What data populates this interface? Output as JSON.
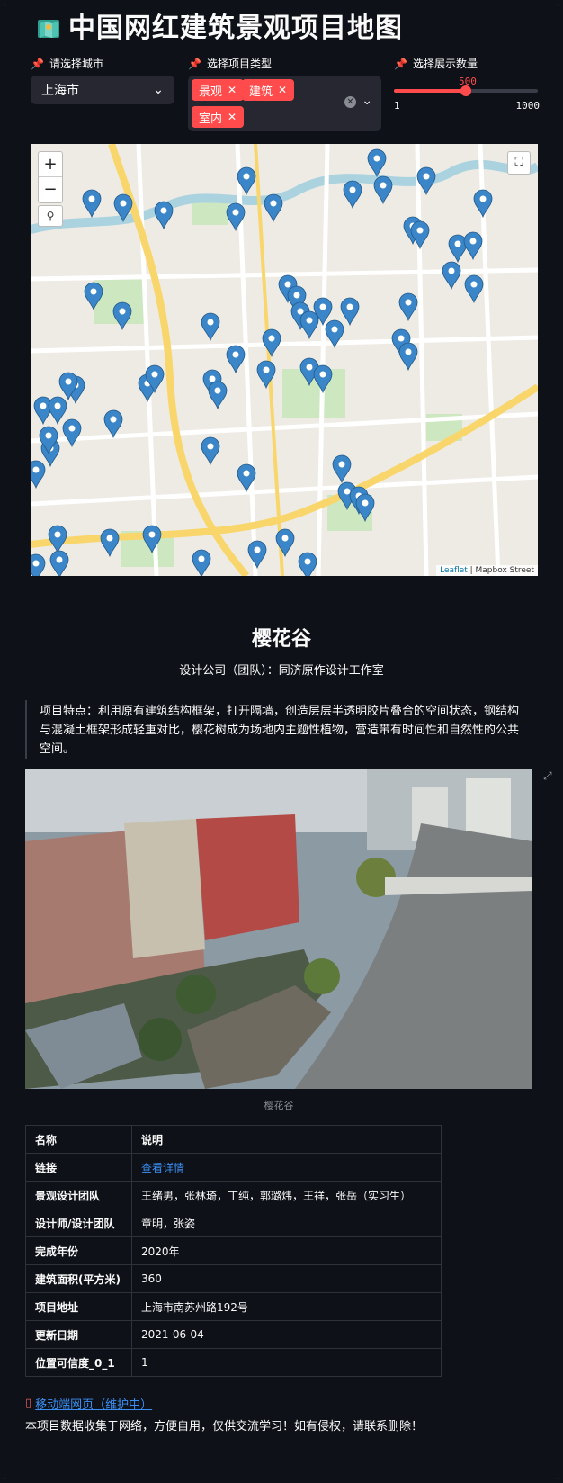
{
  "header": {
    "title": "中国网红建筑景观项目地图",
    "icon": "map-icon"
  },
  "filters": {
    "city_label": "请选择城市",
    "city_value": "上海市",
    "type_label": "选择项目类型",
    "types": [
      "景观",
      "建筑",
      "室内"
    ],
    "count_label": "选择展示数量",
    "count_value": "500",
    "count_min": "1",
    "count_max": "1000",
    "count_fraction": 0.5
  },
  "map": {
    "zoom_in": "+",
    "zoom_out": "−",
    "attribution_leaflet": "Leaflet",
    "attribution_rest": " | Mapbox Street",
    "marker_color": "#3a86c8"
  },
  "project": {
    "name": "樱花谷",
    "company": "设计公司（团队）：同济原作设计工作室",
    "feature": "项目特点：利用原有建筑结构框架，打开隔墙，创造层层半透明胶片叠合的空间状态，钢结构与混凝土框架形成轻重对比，樱花树成为场地内主题性植物，营造带有时间性和自然性的公共空间。",
    "caption": "樱花谷",
    "table": {
      "head": [
        "名称",
        "说明"
      ],
      "rows": [
        [
          "链接",
          "查看详情"
        ],
        [
          "景观设计团队",
          "王绪男，张林琦，丁纯，郭璐炜，王祥，张岳（实习生）"
        ],
        [
          "设计师/设计团队",
          "章明，张姿"
        ],
        [
          "完成年份",
          "2020年"
        ],
        [
          "建筑面积(平方米)",
          "360"
        ],
        [
          "项目地址",
          "上海市南苏州路192号"
        ],
        [
          "更新日期",
          "2021-06-04"
        ],
        [
          "位置可信度_0_1",
          "1"
        ]
      ]
    }
  },
  "footer": {
    "mobile_link": "移动端网页（维护中）",
    "disclaimer": "本项目数据收集于网络，方便自用，仅供交流学习！如有侵权，请联系删除！"
  }
}
